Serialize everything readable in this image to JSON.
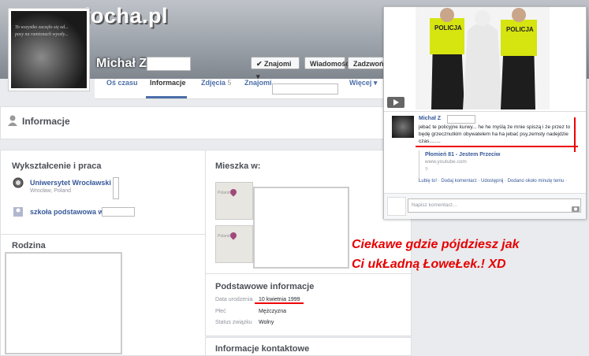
{
  "watermark": "www.wiocha.pl",
  "avatar_quote": "To wszystko zaczęło się od... pasy na ramionach wyszły...",
  "profile": {
    "name": "Michał Z"
  },
  "header_buttons": {
    "friends": "✔ Znajomi ▾",
    "message": "Wiadomość",
    "call": "Zadzwoń"
  },
  "tabs": [
    "Oś czasu",
    "Informacje",
    "Zdjęcia",
    "Znajomi",
    "Więcej ▾"
  ],
  "photos_count": "5",
  "info_title": "Informacje",
  "work_edu": {
    "title": "Wykształcenie i praca",
    "items": [
      {
        "name": "Uniwersytet Wrocławski",
        "sub": "Wrocław, Poland"
      },
      {
        "name": "szkoła podstawowa w ",
        "sub": ""
      }
    ]
  },
  "family": {
    "title": "Rodzina"
  },
  "places": {
    "title": "Mieszka w:",
    "map_label": "Poland"
  },
  "basic": {
    "title": "Podstawowe informacje",
    "rows": [
      {
        "label": "Data urodzenia",
        "value": "10 kwietnia 1999"
      },
      {
        "label": "Płeć",
        "value": "Mężczyzna"
      },
      {
        "label": "Status związku",
        "value": "Wolny"
      }
    ]
  },
  "contact": {
    "title": "Informacje kontaktowe"
  },
  "popup": {
    "vest_label": "POLICJA",
    "author": "Michał Z",
    "comment": "jebać te policyjne kurwy... he he myślą że mnie spiszą i że przez to będę grzecznutkim obywatelem ha ha jebać psy,zemsty nadejdzie czas........",
    "video_title": "Płomień 81 - Jestem Przeciw",
    "video_url": "www.youtube.com",
    "video_more": "?",
    "actions": "Lubię to! · Dodaj komentarz · Udostępnij · Dodano około minutę temu · ",
    "comment_placeholder": "Napisz komentarz..."
  },
  "caption": {
    "line1": "Ciekawe gdzie pójdziesz jak",
    "line2": "Ci ukŁadną ŁoweŁek.! XD"
  }
}
